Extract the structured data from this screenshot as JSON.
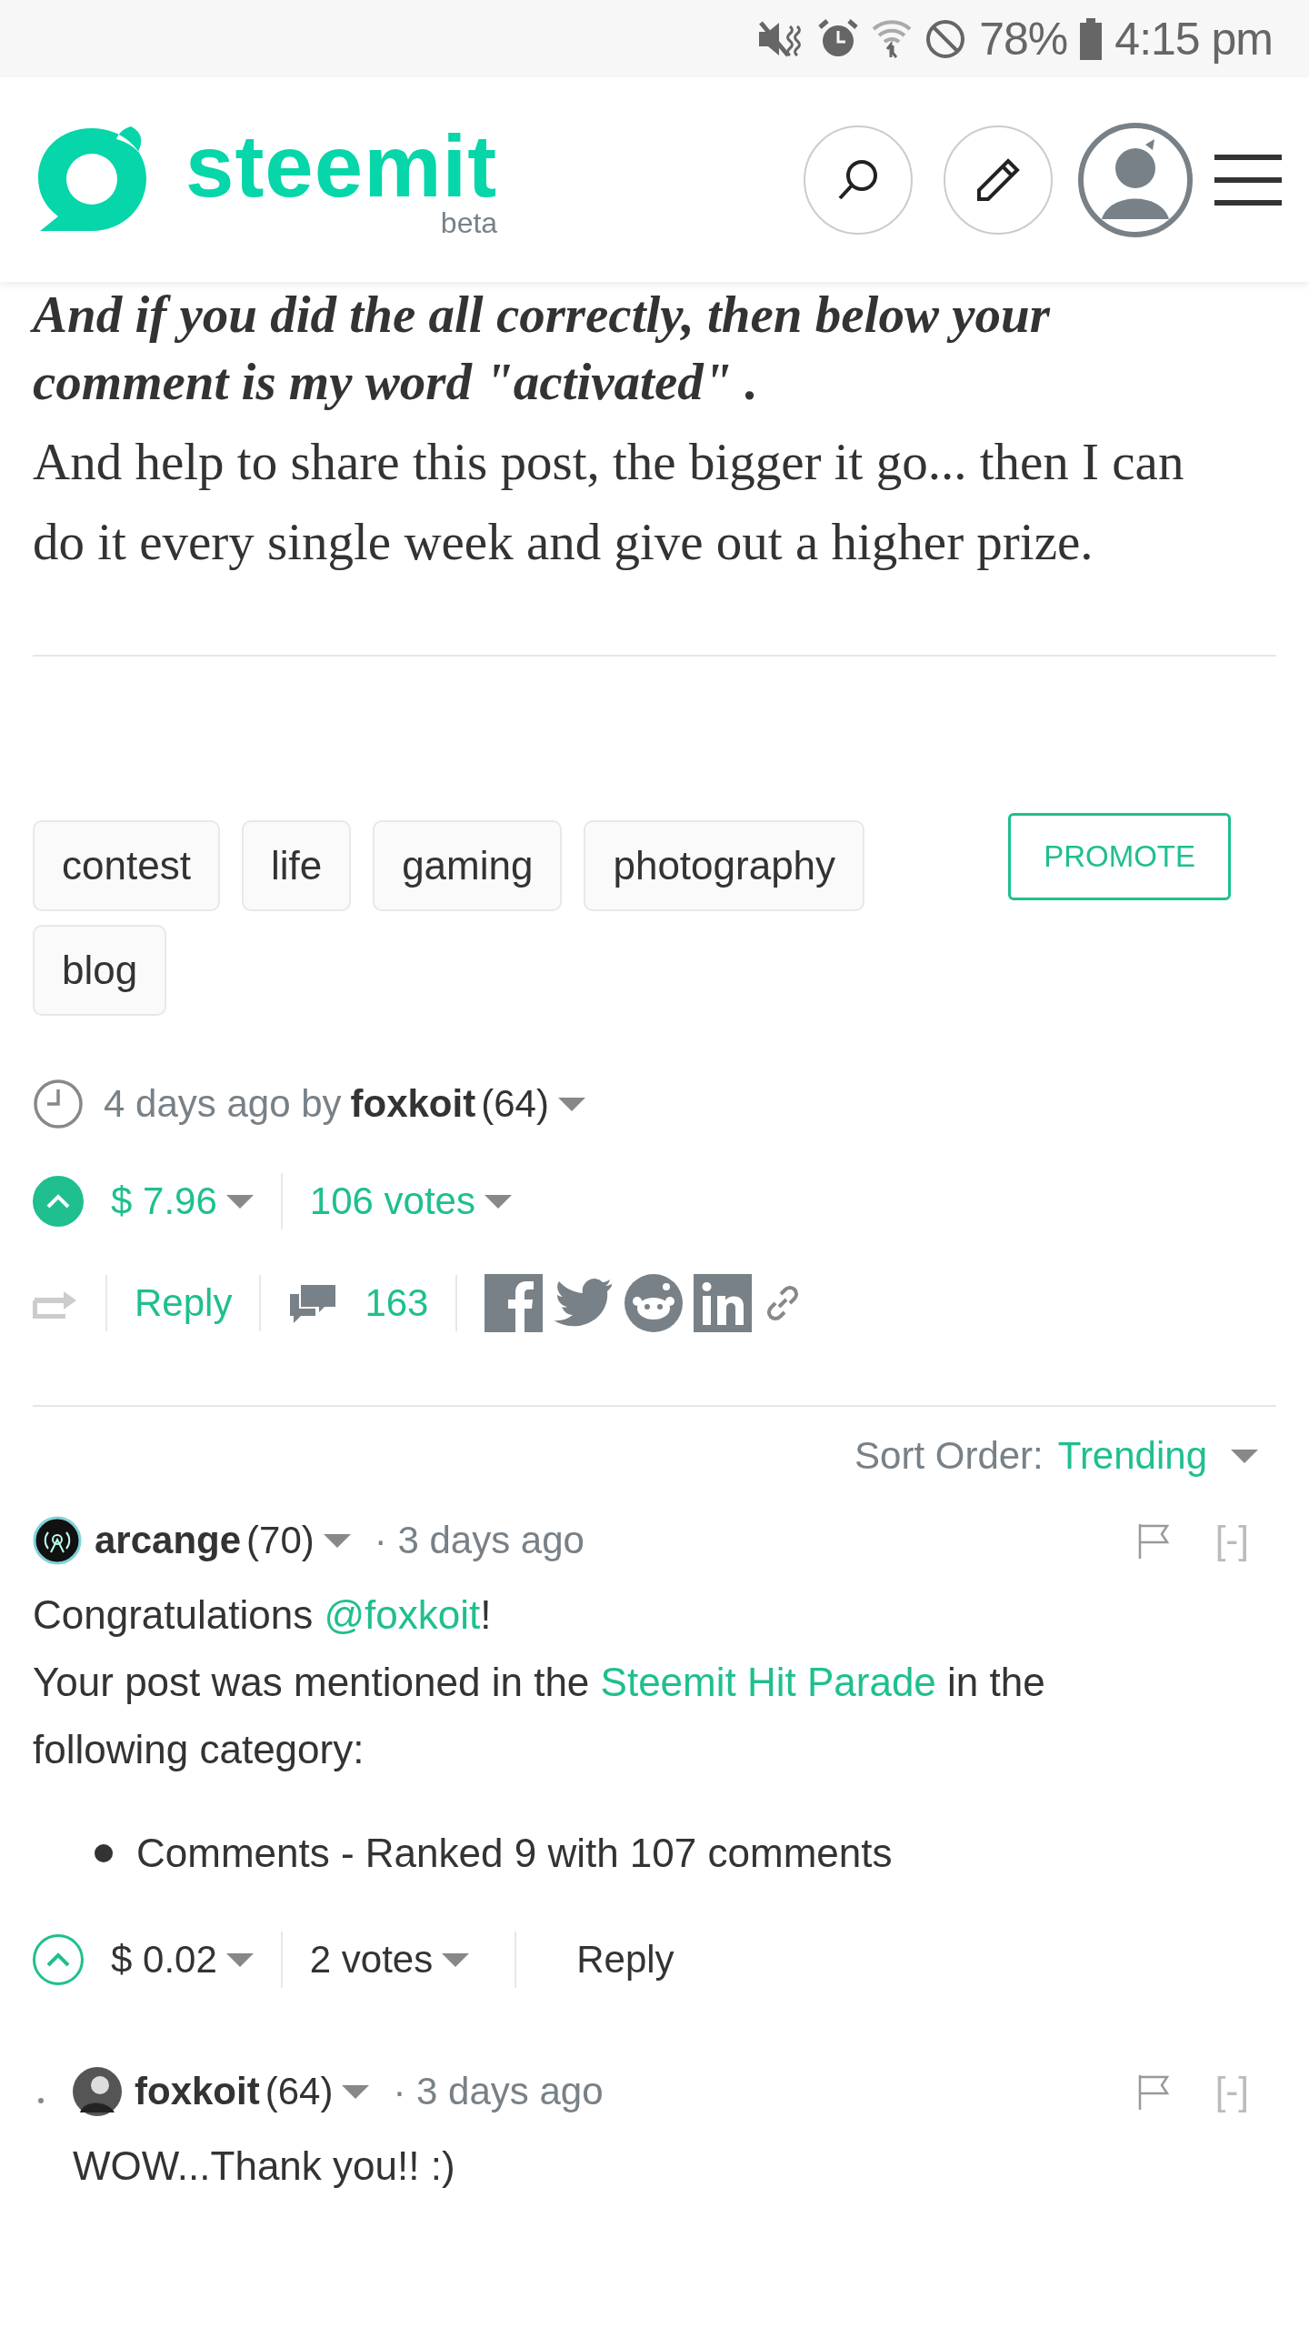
{
  "status_bar": {
    "battery_text": "78%",
    "time": "4:15 pm"
  },
  "header": {
    "logo": "steemit",
    "logo_sub": "beta"
  },
  "post": {
    "cut_line": "And if you did the all correctly, then below your",
    "paragraphs": [
      {
        "kind": "emphasis",
        "text": "comment is my word \"activated\" ."
      },
      {
        "kind": "plain",
        "text": "And help to share this post, the bigger it go... then I can do it every single week and give out a higher prize."
      }
    ],
    "tags": [
      "contest",
      "life",
      "gaming",
      "photography",
      "blog"
    ],
    "promote": "PROMOTE",
    "meta": {
      "age": "4 days ago by",
      "author": "foxkoit",
      "reputation": "(64)"
    },
    "payout": {
      "upvoted": true,
      "amount": "$ 7.96",
      "votes": "106 votes"
    },
    "actions": {
      "reply": "Reply",
      "comments": "163"
    }
  },
  "sort": {
    "label": "Sort Order:",
    "value": "Trending"
  },
  "comments": [
    {
      "author": "arcange",
      "reputation": "(70)",
      "age": "· 3 days ago",
      "nested": false,
      "collapse": "[-]",
      "lines": [
        [
          {
            "kind": "text",
            "text": "Congratulations "
          },
          {
            "kind": "link",
            "text": "@foxkoit"
          },
          {
            "kind": "text",
            "text": "!"
          }
        ],
        [
          {
            "kind": "text",
            "text": "Your post was mentioned in the "
          },
          {
            "kind": "link",
            "text": "Steemit Hit Parade"
          },
          {
            "kind": "text",
            "text": " in the following category:"
          }
        ]
      ],
      "bullets": [
        "Comments - Ranked 9 with 107 comments"
      ],
      "footer": {
        "upvoted": false,
        "amount": "$ 0.02",
        "votes": "2 votes",
        "reply": "Reply"
      }
    },
    {
      "author": "foxkoit",
      "reputation": "(64)",
      "age": "· 3 days ago",
      "nested": true,
      "collapse": "[-]",
      "lines": [
        [
          {
            "kind": "text",
            "text": "WOW...Thank you!! :)"
          }
        ]
      ]
    }
  ]
}
